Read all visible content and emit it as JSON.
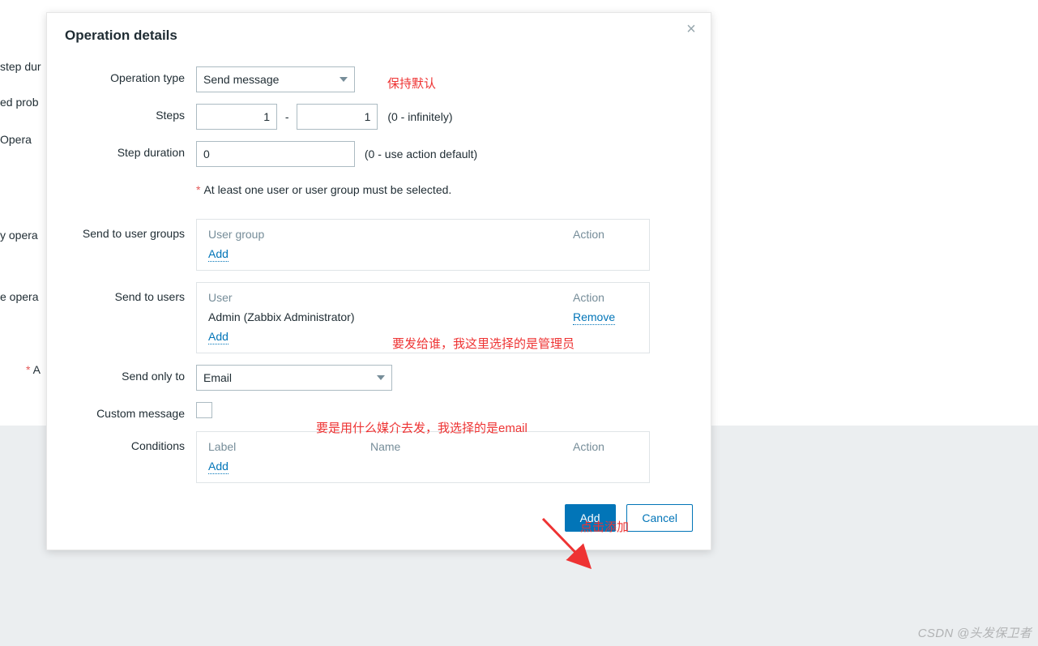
{
  "background": {
    "row1": "step dur",
    "row2": "ed prob",
    "row3": "Opera",
    "row4": "y opera",
    "row5": "e opera",
    "row6_ast": "*",
    "row6": "A"
  },
  "modal": {
    "title": "Operation details",
    "labels": {
      "operation_type": "Operation type",
      "steps": "Steps",
      "step_duration": "Step duration",
      "send_to_user_groups": "Send to user groups",
      "send_to_users": "Send to users",
      "send_only_to": "Send only to",
      "custom_message": "Custom message",
      "conditions": "Conditions"
    },
    "operation_type_value": "Send message",
    "steps_from": "1",
    "steps_to": "1",
    "steps_hint": "(0 - infinitely)",
    "step_duration_value": "0",
    "step_duration_hint": "(0 - use action default)",
    "req_note_ast": "*",
    "req_note": "At least one user or user group must be selected.",
    "user_groups": {
      "headers": {
        "c1": "User group",
        "c2": "Action"
      },
      "add": "Add"
    },
    "users": {
      "headers": {
        "c1": "User",
        "c2": "Action"
      },
      "row1": {
        "name": "Admin (Zabbix Administrator)",
        "remove": "Remove"
      },
      "add": "Add"
    },
    "send_only_to_value": "Email",
    "conditions_tbl": {
      "headers": {
        "c1": "Label",
        "c2": "Name",
        "c3": "Action"
      },
      "add": "Add"
    },
    "actions": {
      "add": "Add",
      "cancel": "Cancel"
    }
  },
  "annotations": {
    "a1": "保持默认",
    "a2": "要发给谁，我这里选择的是管理员",
    "a3": "要是用什么媒介去发，我选择的是email",
    "a4": "点击添加"
  },
  "watermark": "CSDN @头发保卫者"
}
